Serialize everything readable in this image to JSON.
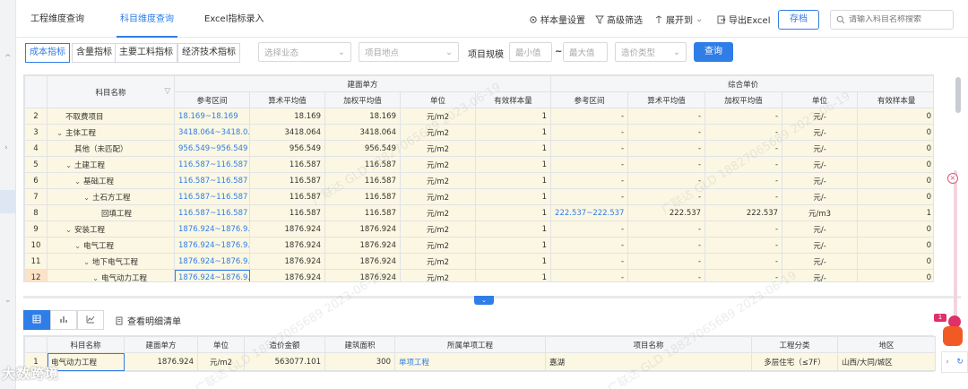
{
  "nav": {
    "tabs": [
      "工程维度查询",
      "科目维度查询",
      "Excel指标录入"
    ],
    "active_tab": 1,
    "actions": [
      {
        "label": "样本量设置",
        "icon": "gear-icon"
      },
      {
        "label": "高级筛选",
        "icon": "filter-icon"
      },
      {
        "label": "展开到",
        "icon": "expand-icon"
      },
      {
        "label": "导出Excel",
        "icon": "export-icon"
      }
    ],
    "save_label": "存档",
    "search_placeholder": "请输入科目名称搜索"
  },
  "filters": {
    "segments": [
      "成本指标",
      "含量指标",
      "主要工料指标",
      "经济技术指标"
    ],
    "active_segment": 0,
    "business_placeholder": "选择业态",
    "location_placeholder": "项目地点",
    "scale_label": "项目规模",
    "min_placeholder": "最小值",
    "range_sep": "~",
    "max_placeholder": "最大值",
    "cost_type_placeholder": "造价类型",
    "query_label": "查询"
  },
  "main_table": {
    "group_headers": [
      "科目名称",
      "建面单方",
      "综合单价"
    ],
    "sub_headers": [
      "参考区间",
      "算术平均值",
      "加权平均值",
      "单位",
      "有效样本量",
      "参考区间",
      "算术平均值",
      "加权平均值",
      "单位",
      "有效样本量"
    ],
    "rows": [
      {
        "no": "2",
        "name": "不取费项目",
        "indent": 0,
        "arrow": "",
        "c": [
          "18.169~18.169",
          "18.169",
          "18.169",
          "元/m2",
          "1",
          "-",
          "-",
          "-",
          "元/-",
          "0"
        ]
      },
      {
        "no": "3",
        "name": "主体工程",
        "indent": 0,
        "arrow": "⌄",
        "c": [
          "3418.064~3418.0...",
          "3418.064",
          "3418.064",
          "元/m2",
          "1",
          "-",
          "-",
          "-",
          "元/-",
          "0"
        ]
      },
      {
        "no": "4",
        "name": "其他（未匹配）",
        "indent": 1,
        "arrow": "",
        "c": [
          "956.549~956.549",
          "956.549",
          "956.549",
          "元/m2",
          "1",
          "-",
          "-",
          "-",
          "元/-",
          "0"
        ]
      },
      {
        "no": "5",
        "name": "土建工程",
        "indent": 1,
        "arrow": "⌄",
        "c": [
          "116.587~116.587",
          "116.587",
          "116.587",
          "元/m2",
          "1",
          "-",
          "-",
          "-",
          "元/-",
          "0"
        ]
      },
      {
        "no": "6",
        "name": "基础工程",
        "indent": 2,
        "arrow": "⌄",
        "c": [
          "116.587~116.587",
          "116.587",
          "116.587",
          "元/m2",
          "1",
          "-",
          "-",
          "-",
          "元/-",
          "0"
        ]
      },
      {
        "no": "7",
        "name": "土石方工程",
        "indent": 3,
        "arrow": "⌄",
        "c": [
          "116.587~116.587",
          "116.587",
          "116.587",
          "元/m2",
          "1",
          "-",
          "-",
          "-",
          "元/-",
          "0"
        ]
      },
      {
        "no": "8",
        "name": "回填工程",
        "indent": 4,
        "arrow": "",
        "c": [
          "116.587~116.587",
          "116.587",
          "116.587",
          "元/m2",
          "1",
          "222.537~222.537",
          "222.537",
          "222.537",
          "元/m3",
          "1"
        ]
      },
      {
        "no": "9",
        "name": "安装工程",
        "indent": 1,
        "arrow": "⌄",
        "c": [
          "1876.924~1876.9...",
          "1876.924",
          "1876.924",
          "元/m2",
          "1",
          "-",
          "-",
          "-",
          "元/-",
          "0"
        ]
      },
      {
        "no": "10",
        "name": "电气工程",
        "indent": 2,
        "arrow": "⌄",
        "c": [
          "1876.924~1876.9...",
          "1876.924",
          "1876.924",
          "元/m2",
          "1",
          "-",
          "-",
          "-",
          "元/-",
          "0"
        ]
      },
      {
        "no": "11",
        "name": "地下电气工程",
        "indent": 3,
        "arrow": "⌄",
        "c": [
          "1876.924~1876.9...",
          "1876.924",
          "1876.924",
          "元/m2",
          "1",
          "-",
          "-",
          "-",
          "元/-",
          "0"
        ]
      },
      {
        "no": "12",
        "name": "电气动力工程",
        "indent": 4,
        "arrow": "⌄",
        "c": [
          "1876.924~1876.9...",
          "1876.924",
          "1876.924",
          "元/m2",
          "1",
          "-",
          "-",
          "-",
          "元/-",
          "0"
        ]
      }
    ]
  },
  "bottom": {
    "detail_label": "查看明细清单",
    "headers": [
      "科目名称",
      "建面单方",
      "单位",
      "造价金额",
      "建筑面积",
      "所属单项工程",
      "项目名称",
      "工程分类",
      "地区"
    ],
    "rows": [
      {
        "no": "1",
        "c": [
          "电气动力工程",
          "1876.924",
          "元/m2",
          "563077.101",
          "300",
          "单项工程",
          "嘉湖",
          "多层住宅（≤7F）",
          "山西/大同/城区"
        ]
      }
    ]
  },
  "float_badge": "1",
  "brand_text": "大数跨境",
  "watermark": "广联达 GLD 18827065689 2023-06-19"
}
